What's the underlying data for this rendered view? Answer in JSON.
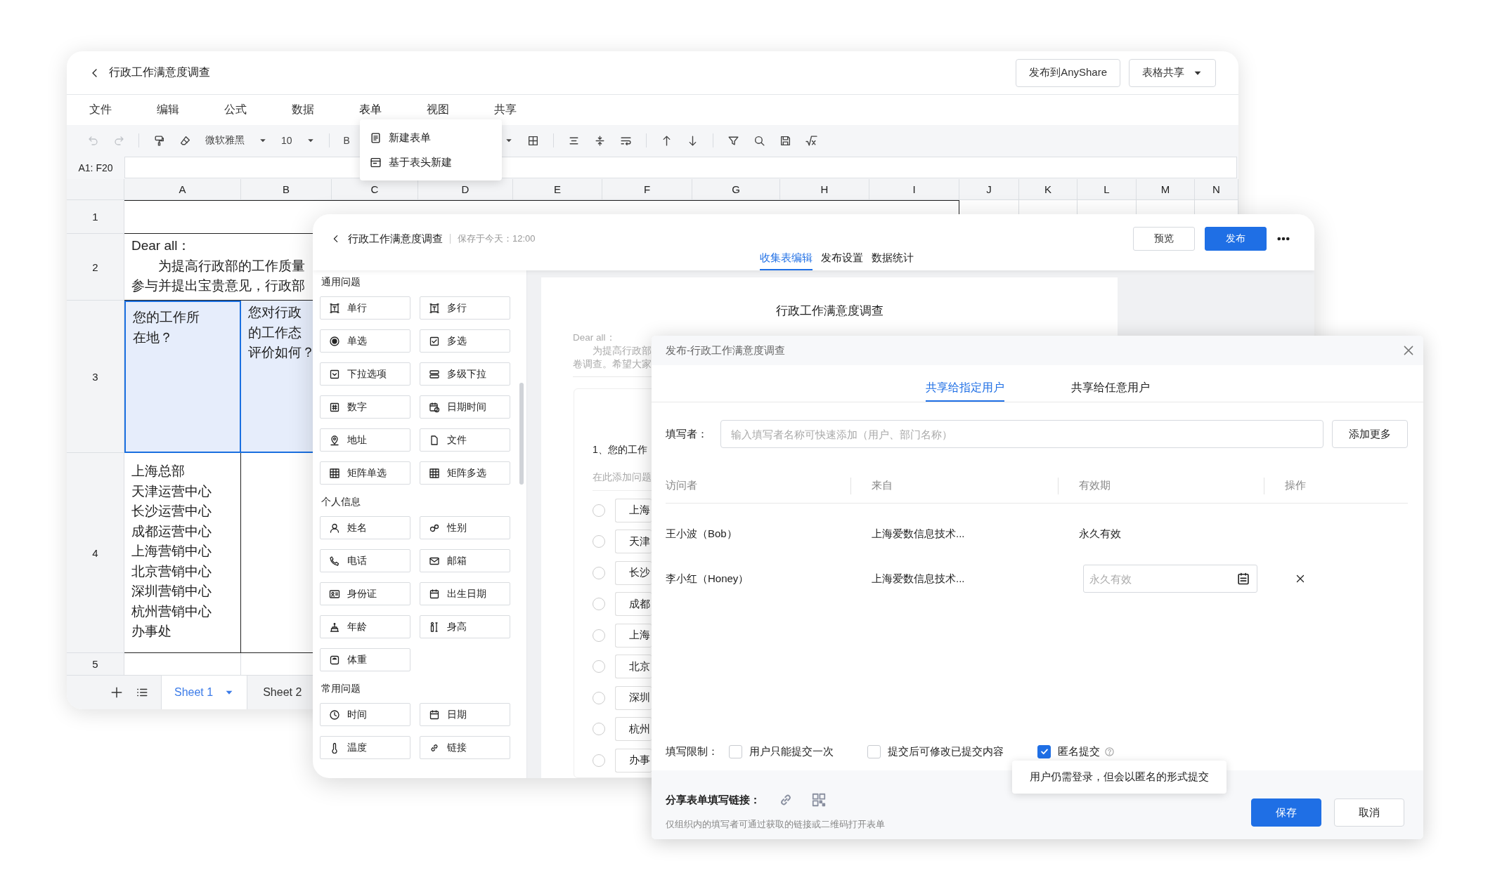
{
  "spreadsheet": {
    "title": "行政工作满意度调查",
    "actions": [
      {
        "label": "发布到AnyShare",
        "kind": "plain"
      },
      {
        "label": "表格共享",
        "kind": "menu"
      }
    ],
    "menu": [
      {
        "label": "文件",
        "expanded": false
      },
      {
        "label": "编辑",
        "expanded": false
      },
      {
        "label": "公式",
        "expanded": false
      },
      {
        "label": "数据",
        "expanded": false
      },
      {
        "label": "表单",
        "expanded": true,
        "items": [
          "新建表单",
          "基于表头新建"
        ]
      },
      {
        "label": "视图",
        "expanded": false
      },
      {
        "label": "共享",
        "expanded": false
      }
    ],
    "font": "微软雅黑",
    "font_size": "10",
    "bold": "B",
    "cell_ref": "A1: F20",
    "columns": [
      "A",
      "B",
      "C",
      "D",
      "E",
      "F",
      "G",
      "H",
      "I",
      "J",
      "K",
      "L",
      "M",
      "N"
    ],
    "rows": [
      {
        "header": "1",
        "cells": [
          {
            "kind": "merged",
            "selected": false
          }
        ]
      },
      {
        "header": "2",
        "cells": [
          {
            "kind": "merged",
            "selected": false,
            "lines": [
              "Dear all：",
              "　　为提高行政部的工作质量",
              "参与并提出宝贵意见，行政部"
            ]
          }
        ]
      },
      {
        "header": "3",
        "cells": [
          {
            "kind": "cell",
            "selected": true,
            "lines": [
              "您的工作所",
              "在地？"
            ]
          },
          {
            "kind": "cell",
            "selected": true,
            "lines": [
              "您对行政",
              "的工作态",
              "评价如何？"
            ]
          }
        ]
      },
      {
        "header": "4",
        "cells": [
          {
            "kind": "cell",
            "selected": false,
            "lines": [
              "上海总部",
              "天津运营中心",
              "长沙运营中心",
              "成都运营中心",
              "上海营销中心",
              "北京营销中心",
              "深圳营销中心",
              "杭州营销中心",
              "办事处"
            ]
          }
        ]
      },
      {
        "header": "5"
      }
    ],
    "sheets": [
      {
        "label": "Sheet 1",
        "selected": true
      },
      {
        "label": "Sheet 2",
        "selected": false
      }
    ]
  },
  "form_editor": {
    "title": "行政工作满意度调查",
    "saved": "保存于今天：12:00",
    "tabs": [
      {
        "label": "收集表编辑",
        "selected": true
      },
      {
        "label": "发布设置",
        "selected": false
      },
      {
        "label": "数据统计",
        "selected": false
      }
    ],
    "buttons": [
      {
        "label": "预览",
        "kind": "secondary"
      },
      {
        "label": "发布",
        "kind": "primary"
      }
    ],
    "groups": [
      {
        "title": "通用问题",
        "items": [
          "单行",
          "多行",
          "单选",
          "多选",
          "下拉选项",
          "多级下拉",
          "数字",
          "日期时间",
          "地址",
          "文件",
          "矩阵单选",
          "矩阵多选"
        ]
      },
      {
        "title": "个人信息",
        "items": [
          "姓名",
          "性别",
          "电话",
          "邮箱",
          "身份证",
          "出生日期",
          "年龄",
          "身高",
          "体重"
        ]
      },
      {
        "title": "常用问题",
        "items": [
          "时间",
          "日期",
          "温度",
          "链接"
        ]
      }
    ],
    "survey": {
      "title": "行政工作满意度调查",
      "intro": [
        "Dear all：",
        "　　为提高行政部",
        "卷调查。希望大家"
      ],
      "question": "1、您的工作",
      "hint": "在此添加问题",
      "options": [
        {
          "label": "上海",
          "selected": false
        },
        {
          "label": "天津",
          "selected": false
        },
        {
          "label": "长沙",
          "selected": false
        },
        {
          "label": "成都",
          "selected": false
        },
        {
          "label": "上海",
          "selected": false
        },
        {
          "label": "北京",
          "selected": false
        },
        {
          "label": "深圳",
          "selected": false
        },
        {
          "label": "杭州",
          "selected": false
        },
        {
          "label": "办事",
          "selected": false
        }
      ]
    }
  },
  "dialog": {
    "title": "发布-行政工作满意度调查",
    "tabs": [
      {
        "label": "共享给指定用户",
        "selected": true
      },
      {
        "label": "共享给任意用户",
        "selected": false
      }
    ],
    "filler": {
      "label": "填写者：",
      "placeholder": "输入填写者名称可快速添加（用户、部门名称）",
      "button": "添加更多"
    },
    "columns": [
      "访问者",
      "来自",
      "有效期",
      "操作"
    ],
    "rows": [
      {
        "visitor": "王小波（Bob）",
        "from": "上海爱数信息技术...",
        "validity": {
          "kind": "text",
          "text": "永久有效"
        },
        "removable": false
      },
      {
        "visitor": "李小红（Honey）",
        "from": "上海爱数信息技术...",
        "validity": {
          "kind": "field",
          "placeholder": "永久有效"
        },
        "removable": true
      }
    ],
    "limits": {
      "label": "填写限制：",
      "options": [
        {
          "label": "用户只能提交一次",
          "checked": false,
          "help": false
        },
        {
          "label": "提交后可修改已提交内容",
          "checked": false,
          "help": false
        },
        {
          "label": "匿名提交",
          "checked": true,
          "help": true
        }
      ]
    },
    "tooltip": "用户仍需登录，但会以匿名的形式提交",
    "share": {
      "label": "分享表单填写链接：",
      "note": "仅组织内的填写者可通过获取的链接或二维码打开表单"
    },
    "buttons": [
      {
        "label": "保存",
        "kind": "primary"
      },
      {
        "label": "取消",
        "kind": "secondary"
      }
    ]
  }
}
